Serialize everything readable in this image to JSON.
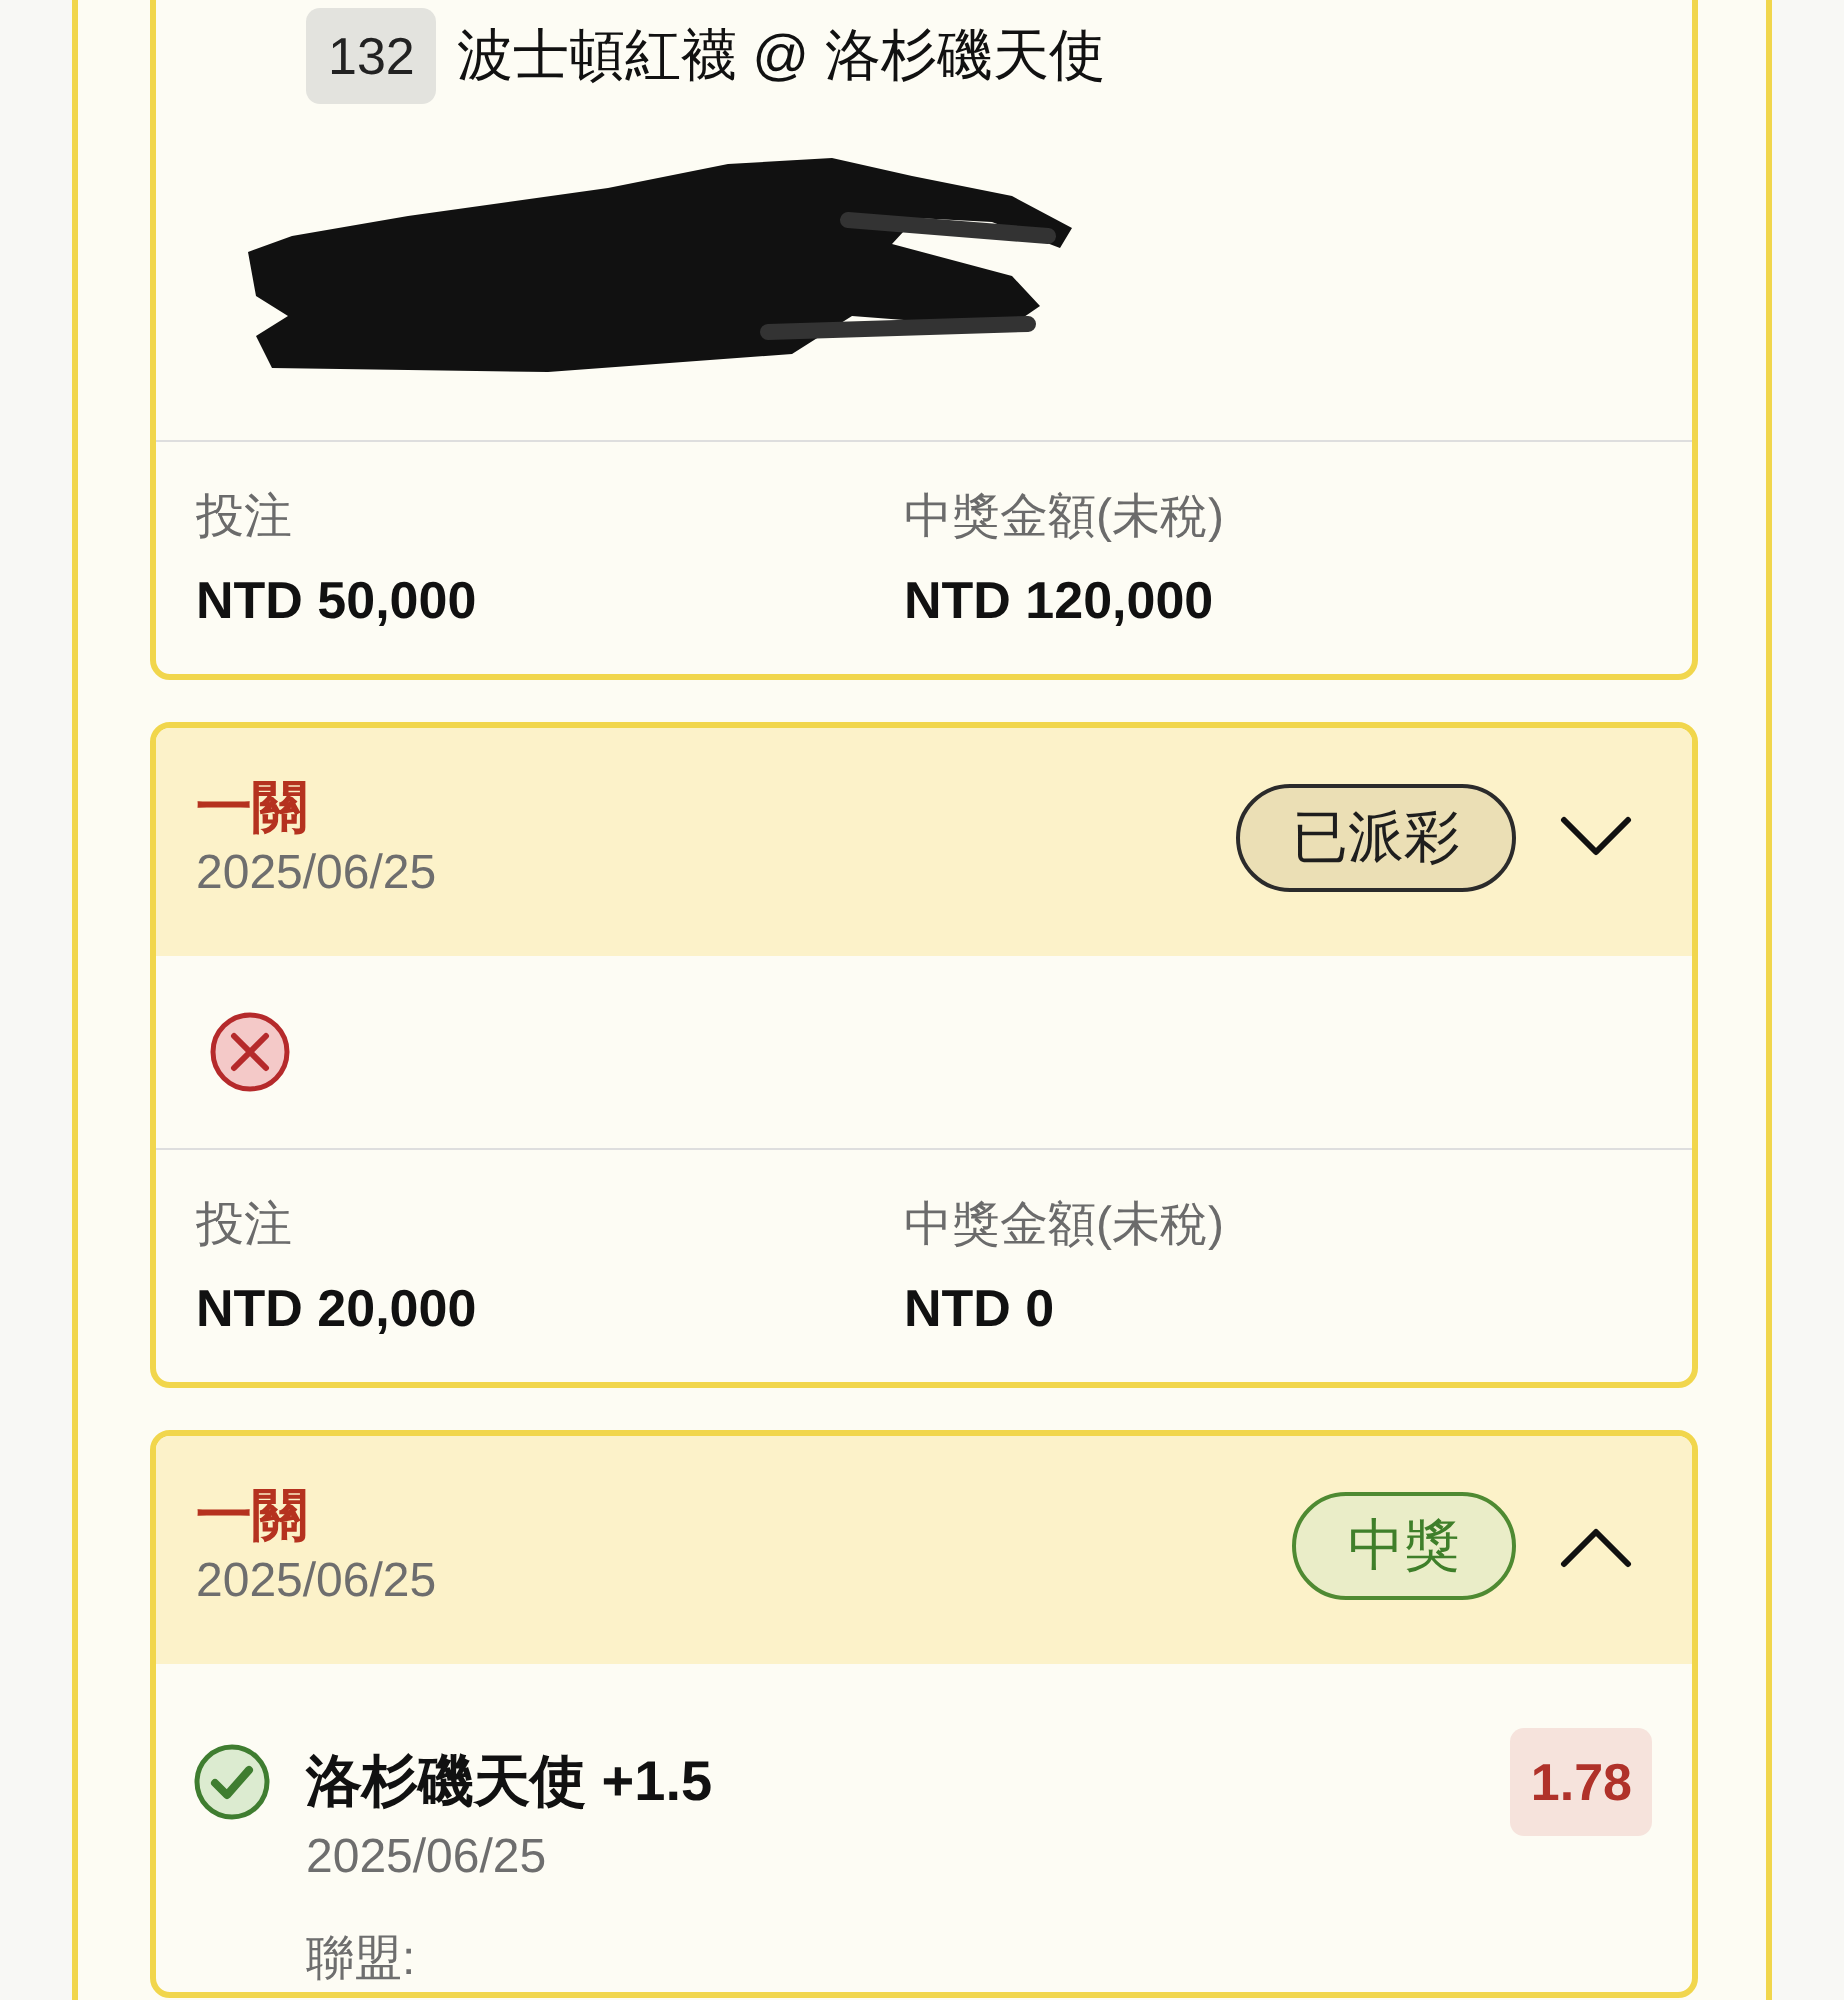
{
  "cards": [
    {
      "selection": {
        "match_number": "132",
        "matchup": "波士頓紅襪 @ 洛杉磯天使",
        "redacted": true
      },
      "stake_label": "投注",
      "stake": "NTD 50,000",
      "payout_label": "中獎金額(未稅)",
      "payout": "NTD 120,000"
    },
    {
      "header": {
        "title": "一關",
        "date": "2025/06/25",
        "status": {
          "label": "已派彩",
          "kind": "paid"
        },
        "expanded": false
      },
      "won": false,
      "stake_label": "投注",
      "stake": "NTD 20,000",
      "payout_label": "中獎金額(未稅)",
      "payout": "NTD 0"
    },
    {
      "header": {
        "title": "一關",
        "date": "2025/06/25",
        "status": {
          "label": "中獎",
          "kind": "won"
        },
        "expanded": true
      },
      "legs": [
        {
          "won": true,
          "pick": "洛杉磯天使 +1.5",
          "date": "2025/06/25",
          "odds": "1.78",
          "league_label": "聯盟:"
        }
      ]
    }
  ]
}
